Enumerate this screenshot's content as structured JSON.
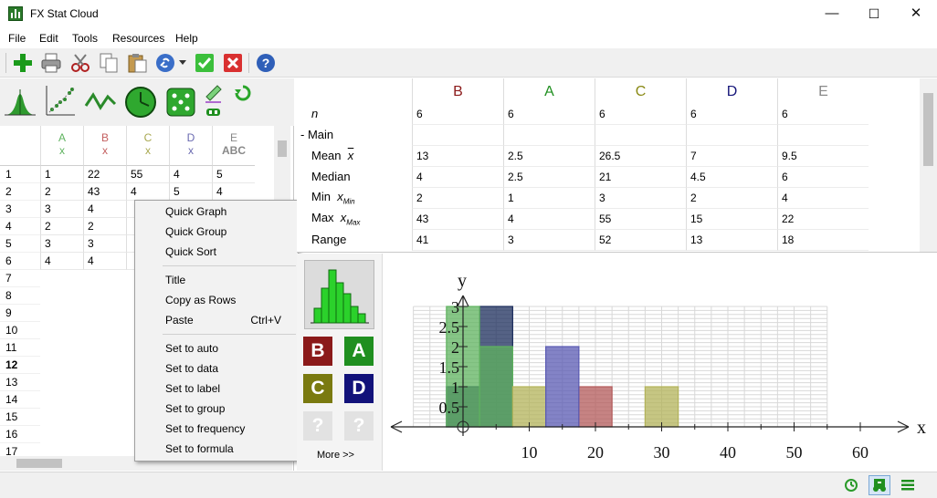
{
  "window": {
    "title": "FX Stat Cloud",
    "minimize": "—",
    "maximize": "☐",
    "close": "✕"
  },
  "menu": [
    "File",
    "Edit",
    "Tools",
    "Resources",
    "Help"
  ],
  "colors": {
    "B": "#8b1a1a",
    "A": "#1f8f1f",
    "C": "#8a8a15",
    "D": "#17177a",
    "E": "#8a8a8a",
    "series_B": "#b35a5a",
    "series_A": "#5fb35f",
    "series_C": "#b3b35a",
    "series_D": "#5a5ab3",
    "series_E": "#1c2d5c"
  },
  "spreadsheet": {
    "columns": [
      {
        "letter": "A",
        "type": "x"
      },
      {
        "letter": "B",
        "type": "x"
      },
      {
        "letter": "C",
        "type": "x"
      },
      {
        "letter": "D",
        "type": "x"
      },
      {
        "letter": "E",
        "type": "ABC"
      }
    ],
    "rows": [
      "1",
      "2",
      "3",
      "4",
      "5",
      "6",
      "7",
      "8",
      "9",
      "10",
      "11",
      "12",
      "13",
      "14",
      "15",
      "16",
      "17"
    ],
    "cells": [
      [
        "1",
        "22",
        "55",
        "4",
        "5"
      ],
      [
        "2",
        "43",
        "4",
        "5",
        "4"
      ],
      [
        "3",
        "4",
        "",
        "",
        " "
      ],
      [
        "2",
        "2",
        "",
        "",
        ""
      ],
      [
        "3",
        "3",
        "",
        "",
        ""
      ],
      [
        "4",
        "4",
        "",
        "",
        ""
      ]
    ]
  },
  "context_menu": {
    "items": [
      {
        "label": "Quick Graph"
      },
      {
        "label": "Quick Group"
      },
      {
        "label": "Quick Sort"
      },
      {
        "label": "Title"
      },
      {
        "label": "Copy as Rows"
      },
      {
        "label": "Paste",
        "shortcut": "Ctrl+V"
      },
      {
        "label": "Set to auto"
      },
      {
        "label": "Set to data"
      },
      {
        "label": "Set to label"
      },
      {
        "label": "Set to group"
      },
      {
        "label": "Set to frequency"
      },
      {
        "label": "Set to formula"
      }
    ]
  },
  "stats": {
    "columns": [
      "B",
      "A",
      "C",
      "D",
      "E"
    ],
    "n_label": "n",
    "section": "- Main",
    "rows": [
      {
        "label": "n",
        "sym": "",
        "values": [
          "6",
          "6",
          "6",
          "6",
          "6"
        ]
      },
      {
        "label": "- Main",
        "sym": "",
        "values": [
          "",
          "",
          "",
          "",
          ""
        ]
      },
      {
        "label": "Mean",
        "sym": "x̄",
        "values": [
          "13",
          "2.5",
          "26.5",
          "7",
          "9.5"
        ]
      },
      {
        "label": "Median",
        "sym": "",
        "values": [
          "4",
          "2.5",
          "21",
          "4.5",
          "6"
        ]
      },
      {
        "label": "Min",
        "sym": "xMin",
        "values": [
          "2",
          "1",
          "3",
          "2",
          "4"
        ]
      },
      {
        "label": "Max",
        "sym": "xMax",
        "values": [
          "43",
          "4",
          "55",
          "15",
          "22"
        ]
      },
      {
        "label": "Range",
        "sym": "",
        "values": [
          "41",
          "3",
          "52",
          "13",
          "18"
        ]
      }
    ]
  },
  "graph_panel": {
    "buttons": [
      {
        "letter": "B",
        "color": "#8b1a1a"
      },
      {
        "letter": "A",
        "color": "#1f8f1f"
      },
      {
        "letter": "C",
        "color": "#7a7a10"
      },
      {
        "letter": "D",
        "color": "#12127a"
      },
      {
        "letter": "?",
        "color": "#e2e2e2"
      },
      {
        "letter": "?",
        "color": "#e2e2e2"
      }
    ],
    "more": "More >>"
  },
  "chart_data": {
    "type": "bar",
    "title": "",
    "xlabel": "x",
    "ylabel": "y",
    "xlim": [
      -12,
      68
    ],
    "ylim": [
      0,
      3
    ],
    "x_ticks": [
      10,
      20,
      30,
      40,
      50,
      60
    ],
    "y_ticks": [
      "0.5",
      "1",
      "1.5",
      "2",
      "2.5",
      "3"
    ],
    "bin_width": 5,
    "series": [
      {
        "name": "E",
        "color": "#1c2d5c",
        "bins": [
          {
            "x0": -2.5,
            "count": 1
          },
          {
            "x0": 2.5,
            "count": 3
          }
        ]
      },
      {
        "name": "A",
        "color": "#5fb35f",
        "bins": [
          {
            "x0": -2.5,
            "count": 3
          },
          {
            "x0": 2.5,
            "count": 2
          }
        ]
      },
      {
        "name": "B",
        "color": "#b35a5a",
        "bins": [
          {
            "x0": 17.5,
            "count": 1
          }
        ]
      },
      {
        "name": "C",
        "color": "#b3b35a",
        "bins": [
          {
            "x0": 7.5,
            "count": 1
          },
          {
            "x0": 27.5,
            "count": 1
          }
        ]
      },
      {
        "name": "D",
        "color": "#5a5ab3",
        "bins": [
          {
            "x0": 12.5,
            "count": 2
          }
        ]
      }
    ]
  }
}
